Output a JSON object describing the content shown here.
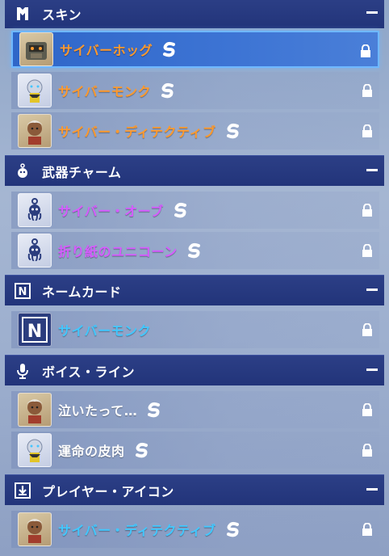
{
  "sections": [
    {
      "title": "スキン",
      "icon": "skin-icon",
      "items": [
        {
          "label": "サイバーホッグ",
          "color": "#ff9a2e",
          "thumb": "hog-avatar",
          "badge": "s-icon",
          "selected": true
        },
        {
          "label": "サイバーモンク",
          "color": "#ff9a2e",
          "thumb": "monk-avatar",
          "badge": "s-icon",
          "selected": false
        },
        {
          "label": "サイバー・ディテクティブ",
          "color": "#ff9a2e",
          "thumb": "detective-avatar",
          "badge": "s-icon",
          "selected": false
        }
      ]
    },
    {
      "title": "武器チャーム",
      "icon": "charm-icon",
      "items": [
        {
          "label": "サイバー・オーブ",
          "color": "#d65cff",
          "thumb": "octopus-charm",
          "badge": "s-icon"
        },
        {
          "label": "折り紙のユニコーン",
          "color": "#d65cff",
          "thumb": "octopus-charm",
          "badge": "s-icon"
        }
      ]
    },
    {
      "title": "ネームカード",
      "icon": "namecard-icon",
      "items": [
        {
          "label": "サイバーモンク",
          "color": "#42c8ff",
          "thumb": "namecard-n",
          "badge": ""
        }
      ]
    },
    {
      "title": "ボイス・ライン",
      "icon": "microphone-icon",
      "items": [
        {
          "label": "泣いたって…",
          "color": "#ffffff",
          "thumb": "detective-avatar",
          "badge": "s-icon"
        },
        {
          "label": "運命の皮肉",
          "color": "#ffffff",
          "thumb": "monk-avatar",
          "badge": "s-icon"
        }
      ]
    },
    {
      "title": "プレイヤー・アイコン",
      "icon": "player-icon-icon",
      "items": [
        {
          "label": "サイバー・ディテクティブ",
          "color": "#42c8ff",
          "thumb": "detective-avatar",
          "badge": "s-icon"
        }
      ]
    }
  ],
  "namecard_letter": "N"
}
